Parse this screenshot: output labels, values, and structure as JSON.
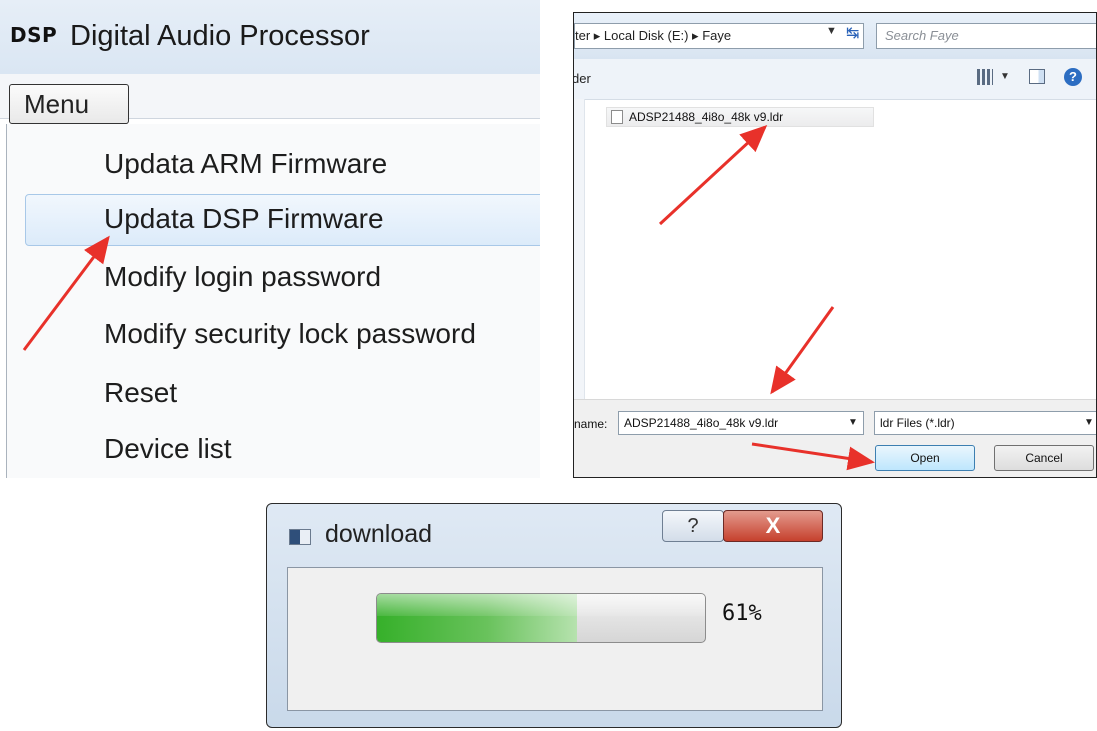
{
  "menu_window": {
    "logo": "DSP",
    "title": "Digital Audio Processor",
    "menu_label": "Menu",
    "items": [
      {
        "label": "Updata ARM Firmware"
      },
      {
        "label": "Updata DSP Firmware"
      },
      {
        "label": "Modify login password"
      },
      {
        "label": "Modify security lock password"
      },
      {
        "label": "Reset"
      },
      {
        "label": "Device list"
      }
    ],
    "highlighted_item": "Updata DSP Firmware"
  },
  "open_dialog": {
    "breadcrumb": "ter ▸ Local Disk (E:) ▸ Faye",
    "search_placeholder": "Search Faye",
    "toolbar_label": "der",
    "file": "ADSP21488_4i8o_48k v9.ldr",
    "filename_label": "name:",
    "filename_value": "ADSP21488_4i8o_48k v9.ldr",
    "filetype": "ldr Files (*.ldr)",
    "open_label": "Open",
    "cancel_label": "Cancel",
    "icons": [
      "dropdown-icon",
      "refresh-icon",
      "view-icon",
      "preview-pane-icon",
      "help-icon",
      "file-icon"
    ]
  },
  "download_dialog": {
    "title": "download",
    "help_label": "?",
    "close_label": "X",
    "progress": 61,
    "progress_text": "61%",
    "progress_color": "#36b02a"
  },
  "annotation_color": "#e8312a"
}
